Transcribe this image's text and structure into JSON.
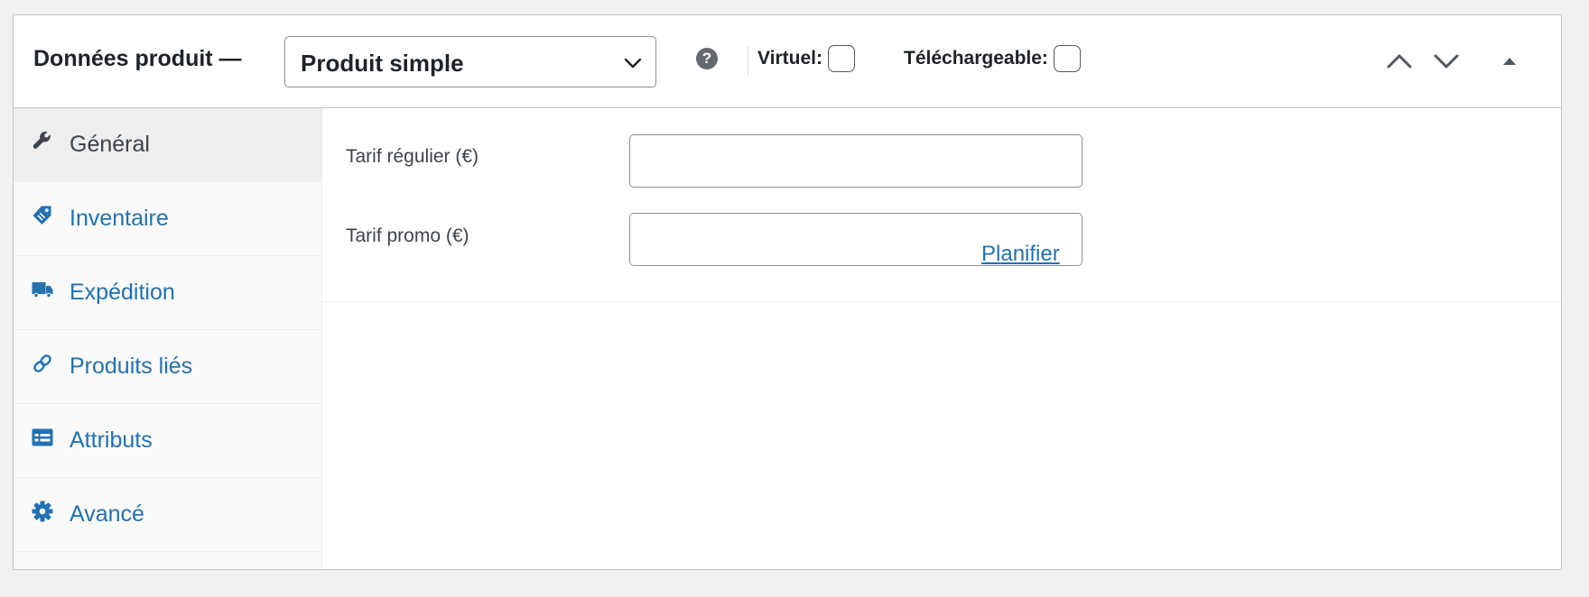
{
  "panel": {
    "title": "Données produit —",
    "product_type": {
      "selected": "Produit simple"
    },
    "help_icon_glyph": "?",
    "virtual": {
      "label": "Virtuel:",
      "checked": false
    },
    "downloadable": {
      "label": "Téléchargeable:",
      "checked": false
    }
  },
  "tabs": [
    {
      "label": "Général",
      "icon": "wrench-icon",
      "active": true
    },
    {
      "label": "Inventaire",
      "icon": "tag-icon",
      "active": false
    },
    {
      "label": "Expédition",
      "icon": "truck-icon",
      "active": false
    },
    {
      "label": "Produits liés",
      "icon": "link-icon",
      "active": false
    },
    {
      "label": "Attributs",
      "icon": "list-view-icon",
      "active": false
    },
    {
      "label": "Avancé",
      "icon": "gear-icon",
      "active": false
    }
  ],
  "fields": {
    "regular_price": {
      "label": "Tarif régulier (€)",
      "value": ""
    },
    "sale_price": {
      "label": "Tarif promo (€)",
      "value": ""
    },
    "schedule_link": "Planifier"
  },
  "colors": {
    "link": "#2271b1",
    "text": "#1d2327",
    "tab_bg": "#fafafa",
    "active_tab_bg": "#eeeeee",
    "page_bg": "#f0f0f1"
  }
}
